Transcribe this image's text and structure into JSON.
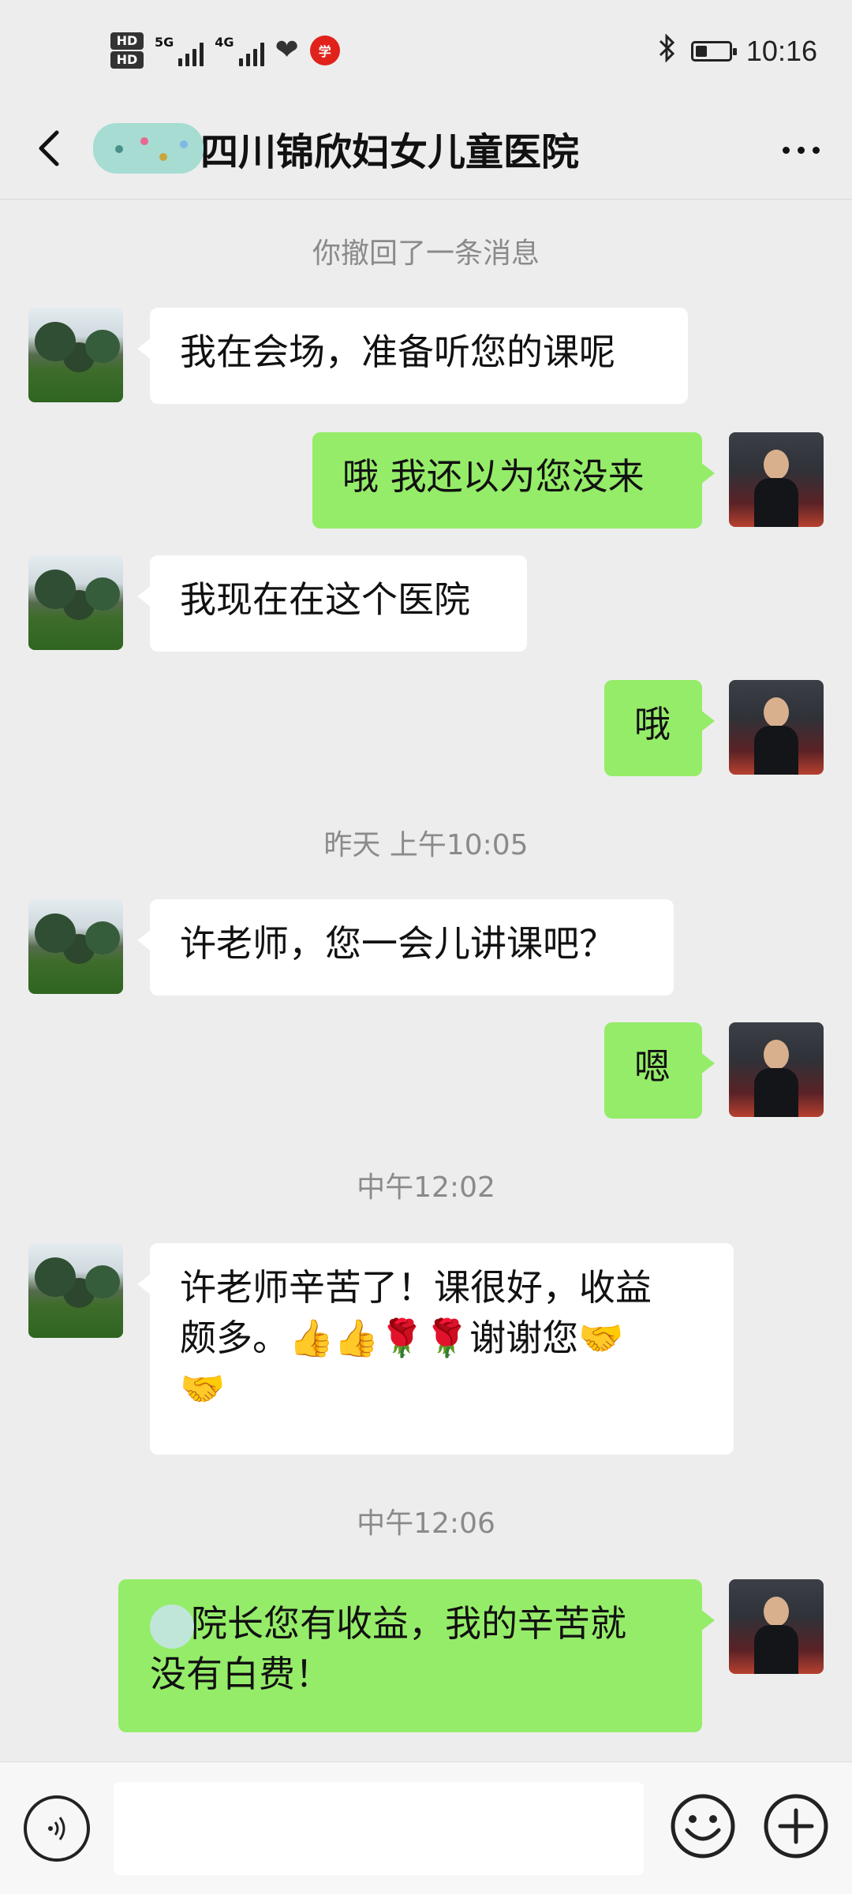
{
  "status_bar": {
    "hd1": "HD",
    "hd2": "HD",
    "net1": "5G",
    "net2": "4G",
    "badge": "学",
    "time": "10:16"
  },
  "header": {
    "title": "四川锦欣妇女儿童医院"
  },
  "chat": {
    "recalled_notice": "你撤回了一条消息",
    "time_1": "昨天 上午10:05",
    "time_2": "中午12:02",
    "time_3": "中午12:06",
    "messages": [
      {
        "side": "left",
        "text": "我在会场，准备听您的课呢"
      },
      {
        "side": "right",
        "text": "哦 我还以为您没来"
      },
      {
        "side": "left",
        "text": "我现在在这个医院"
      },
      {
        "side": "right",
        "text": "哦"
      },
      {
        "side": "left",
        "text": "许老师，您一会儿讲课吧？"
      },
      {
        "side": "right",
        "text": "嗯"
      },
      {
        "side": "left",
        "text_line1": "许老师辛苦了！课很好，收益",
        "text_line2": "颇多。",
        "emojis_line2": "👍👍🌹🌹",
        "text_line2b": "谢谢您",
        "emoji_end": "🤝",
        "emoji_line3": "🤝"
      },
      {
        "side": "right",
        "text_line1": "院长您有收益，我的辛苦就",
        "text_line2": "没有白费！"
      }
    ]
  },
  "input": {
    "placeholder": ""
  },
  "colors": {
    "background": "#ededed",
    "sent_bubble": "#95ec69",
    "received_bubble": "#ffffff"
  },
  "icons": [
    "back-arrow-icon",
    "more-icon",
    "voice-icon",
    "emoji-icon",
    "plus-icon",
    "bluetooth-icon",
    "battery-icon",
    "heart-rate-icon"
  ]
}
